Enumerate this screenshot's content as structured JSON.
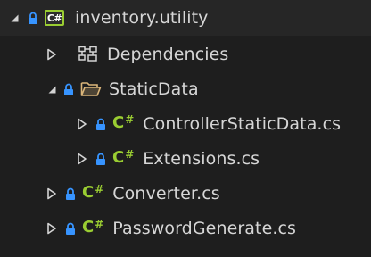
{
  "solution_explorer": {
    "project": {
      "badge": "C#",
      "name": "inventory.utility"
    },
    "items": [
      {
        "label": "Dependencies"
      },
      {
        "label": "StaticData"
      },
      {
        "label": "ControllerStaticData.cs",
        "icon_text": "C",
        "icon_hash": "#"
      },
      {
        "label": "Extensions.cs",
        "icon_text": "C",
        "icon_hash": "#"
      },
      {
        "label": "Converter.cs",
        "icon_text": "C",
        "icon_hash": "#"
      },
      {
        "label": "PasswordGenerate.cs",
        "icon_text": "C",
        "icon_hash": "#"
      }
    ]
  },
  "colors": {
    "background": "#1e1e1e",
    "text": "#d6d6d6",
    "csharp_green": "#9acd32",
    "lock_blue": "#3794ff",
    "folder_yellow": "#dcb67a"
  },
  "icons": {
    "expanded": "triangle-down-filled-icon",
    "collapsed": "triangle-right-outline-icon",
    "lock": "lock-icon",
    "project": "csharp-project-icon",
    "dependencies": "dependencies-icon",
    "folder": "folder-open-icon",
    "csharp_file": "csharp-file-icon"
  }
}
